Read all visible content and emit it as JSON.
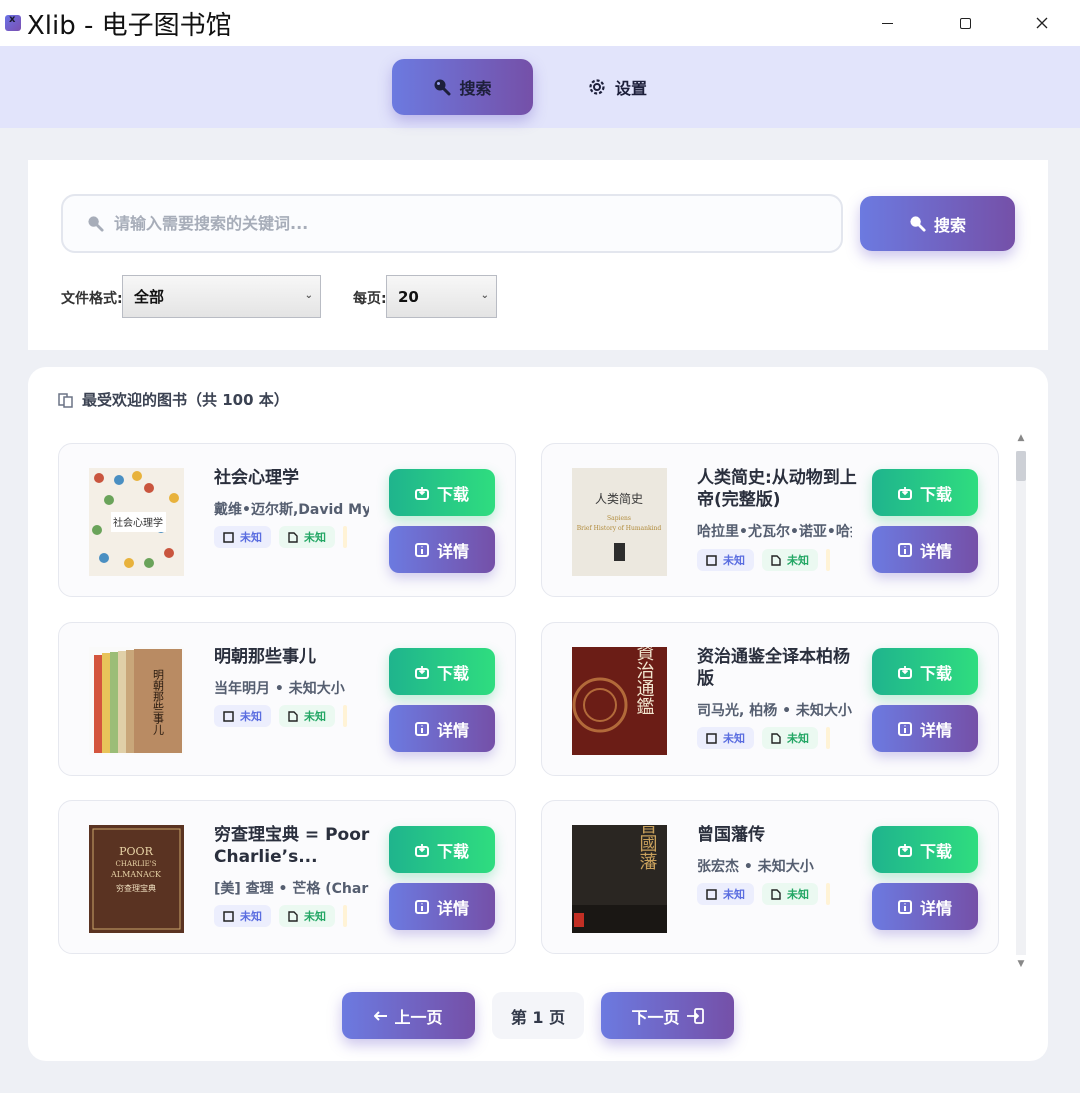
{
  "window": {
    "title": "Xlib - 电子图书馆"
  },
  "nav": {
    "search_label": "搜索",
    "settings_label": "设置"
  },
  "search": {
    "placeholder": "请输入需要搜索的关键词...",
    "button_label": "搜索"
  },
  "filters": {
    "format_label": "文件格式:",
    "format_value": "全部",
    "per_page_label": "每页:",
    "per_page_value": "20"
  },
  "results": {
    "title": "最受欢迎的图书（共 100 本）",
    "download_label": "下载",
    "detail_label": "详情",
    "books": [
      {
        "title": "社会心理学",
        "meta": "戴维•迈尔斯,David Myers",
        "tag1": "未知",
        "tag2": "未知"
      },
      {
        "title": "人类简史:从动物到上帝(完整版)",
        "meta": "哈拉里•尤瓦尔•诺亚•哈拉里",
        "tag1": "未知",
        "tag2": "未知"
      },
      {
        "title": "明朝那些事儿",
        "meta": "当年明月 • 未知大小",
        "tag1": "未知",
        "tag2": "未知"
      },
      {
        "title": "资治通鉴全译本柏杨版",
        "meta": "司马光, 柏杨 • 未知大小",
        "tag1": "未知",
        "tag2": "未知"
      },
      {
        "title": "穷查理宝典 = Poor Charlie’s...",
        "meta": "[美] 查理 • 芒格 (Charlie Munger)",
        "tag1": "未知",
        "tag2": "未知"
      },
      {
        "title": "曾国藩传",
        "meta": "张宏杰 • 未知大小",
        "tag1": "未知",
        "tag2": "未知"
      }
    ],
    "covers": {
      "b2_top": "Sapiens",
      "b2_sub": "Brief History of Humankind",
      "b2_cn": "人类简史",
      "b4_cn": "資治通鑑",
      "b5_en1": "POOR",
      "b5_en2": "CHARLIE'S",
      "b5_en3": "ALMANACK",
      "b5_cn": "穷查理宝典",
      "b6_cn": "曾國藩",
      "b1_cn": "社会心理学",
      "b3_cn": "明朝那些事儿"
    }
  },
  "pager": {
    "prev_label": "上一页",
    "page_label": "第 1 页",
    "next_label": "下一页"
  }
}
